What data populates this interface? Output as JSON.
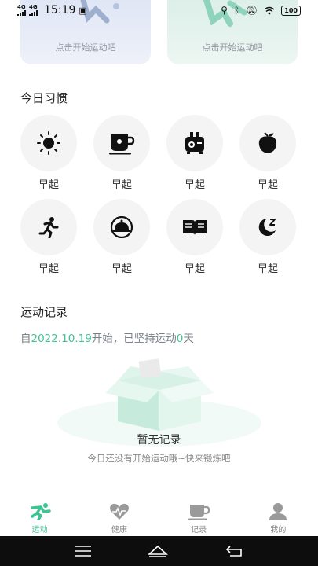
{
  "status_bar": {
    "signal_1": "4G",
    "signal_2": "4G",
    "time": "15:19",
    "battery": "100"
  },
  "cards": {
    "left_hint": "点击开始运动吧",
    "right_hint": "点击开始运动吧"
  },
  "habits": {
    "title": "今日习惯",
    "items": [
      {
        "label": "早起",
        "icon": "sun-icon"
      },
      {
        "label": "早起",
        "icon": "tea-cup-icon"
      },
      {
        "label": "早起",
        "icon": "toaster-icon"
      },
      {
        "label": "早起",
        "icon": "fruit-icon"
      },
      {
        "label": "早起",
        "icon": "running-icon"
      },
      {
        "label": "早起",
        "icon": "food-dome-icon"
      },
      {
        "label": "早起",
        "icon": "book-icon"
      },
      {
        "label": "早起",
        "icon": "moon-sleep-icon"
      }
    ]
  },
  "records": {
    "title": "运动记录",
    "prefix": "自",
    "start_date": "2022.10.19",
    "middle": "开始，已坚持运动",
    "days": "0",
    "suffix": "天"
  },
  "empty": {
    "title": "暂无记录",
    "subtitle": "今日还没有开始运动哦~快来锻炼吧"
  },
  "tabs": [
    {
      "label": "运动",
      "icon": "exercise-icon",
      "active": true
    },
    {
      "label": "健康",
      "icon": "heart-icon",
      "active": false
    },
    {
      "label": "记录",
      "icon": "cup-record-icon",
      "active": false
    },
    {
      "label": "我的",
      "icon": "user-icon",
      "active": false
    }
  ],
  "colors": {
    "accent": "#3ec493",
    "icon": "#111111",
    "circle_bg": "#f4f4f4"
  }
}
